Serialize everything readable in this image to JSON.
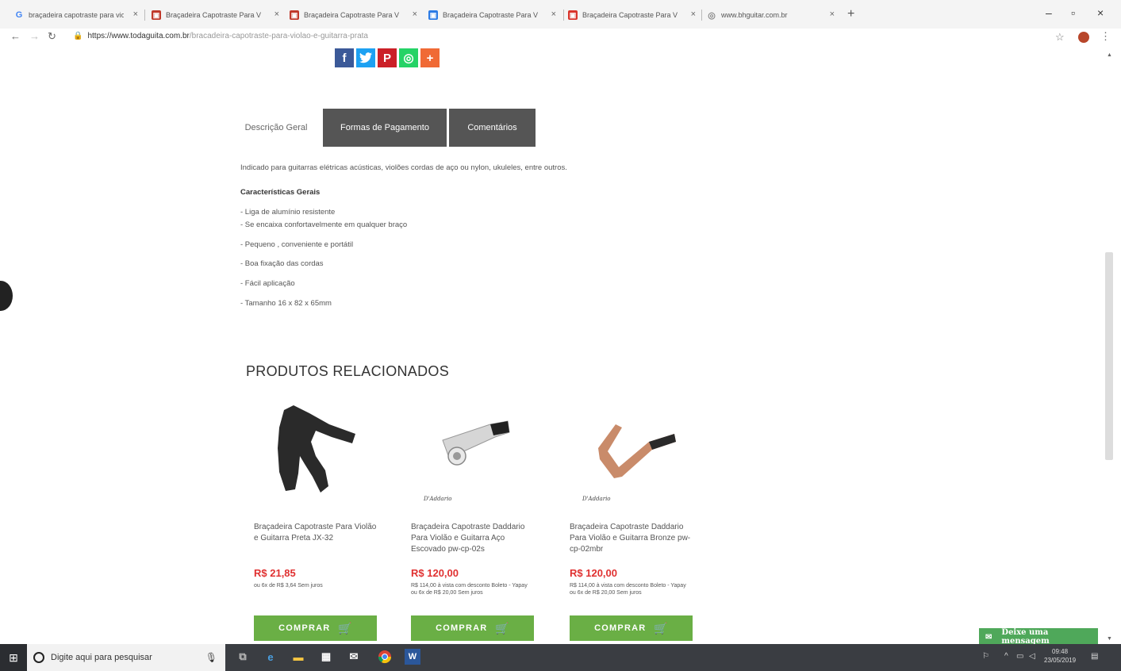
{
  "browser": {
    "tabs": [
      {
        "label": "braçadeira capotraste para violã",
        "icon": "google-icon"
      },
      {
        "label": "Braçadeira Capotraste Para Viol",
        "icon": "store-icon"
      },
      {
        "label": "Braçadeira Capotraste Para Viol",
        "icon": "store-icon"
      },
      {
        "label": "Braçadeira Capotraste Para Viol",
        "icon": "store-icon"
      },
      {
        "label": "Braçadeira Capotraste Para Viol",
        "icon": "store-icon"
      },
      {
        "label": "www.bhguitar.com.br",
        "icon": "globe-icon"
      }
    ],
    "url_host": "https://www.todaguita.com.br",
    "url_path": "/bracadeira-capotraste-para-violao-e-guitarra-prata"
  },
  "product_tabs": [
    "Descrição Geral",
    "Formas de Pagamento",
    "Comentários"
  ],
  "description": {
    "intro": "Indicado para guitarras elétricas acústicas, violões cordas de aço ou nylon, ukuleles, entre outros.",
    "features_title": "Características Gerais",
    "features": [
      "- Liga de alumínio resistente",
      "- Se encaixa confortavelmente em qualquer braço",
      "- Pequeno , conveniente e portátil",
      "- Boa fixação das cordas",
      "- Fácil aplicação",
      "- Tamanho 16 x 82 x 65mm"
    ]
  },
  "related": {
    "title": "PRODUTOS RELACIONADOS",
    "products": [
      {
        "name": "Braçadeira Capotraste Para Violão e Guitarra Preta JX-32",
        "price": "R$ 21,85",
        "installments": "ou 6x de R$ 3,64 Sem juros",
        "brand": "",
        "buy_label": "COMPRAR",
        "color": "#333333"
      },
      {
        "name": "Braçadeira Capotraste Daddario Para Violão e Guitarra Aço Escovado pw-cp-02s",
        "price": "R$ 120,00",
        "boleto": "R$ 114,00 à vista com desconto Boleto - Yapay",
        "installments": "ou 6x de R$ 20,00 Sem juros",
        "brand": "D'Addario",
        "buy_label": "COMPRAR",
        "color": "#c0c0c0"
      },
      {
        "name": "Braçadeira Capotraste Daddario Para Violão e Guitarra Bronze pw-cp-02mbr",
        "price": "R$ 120,00",
        "boleto": "R$ 114,00 à vista com desconto Boleto - Yapay",
        "installments": "ou 6x de R$ 20,00 Sem juros",
        "brand": "D'Addario",
        "buy_label": "COMPRAR",
        "color": "#c98b6a"
      }
    ]
  },
  "chat": {
    "label": "Deixe uma mensagem"
  },
  "taskbar": {
    "search_placeholder": "Digite aqui para pesquisar",
    "time": "09:48",
    "date": "23/05/2019"
  },
  "colors": {
    "buy_button": "#6aaf45",
    "price": "#e03131",
    "tab_dark": "#555555"
  }
}
